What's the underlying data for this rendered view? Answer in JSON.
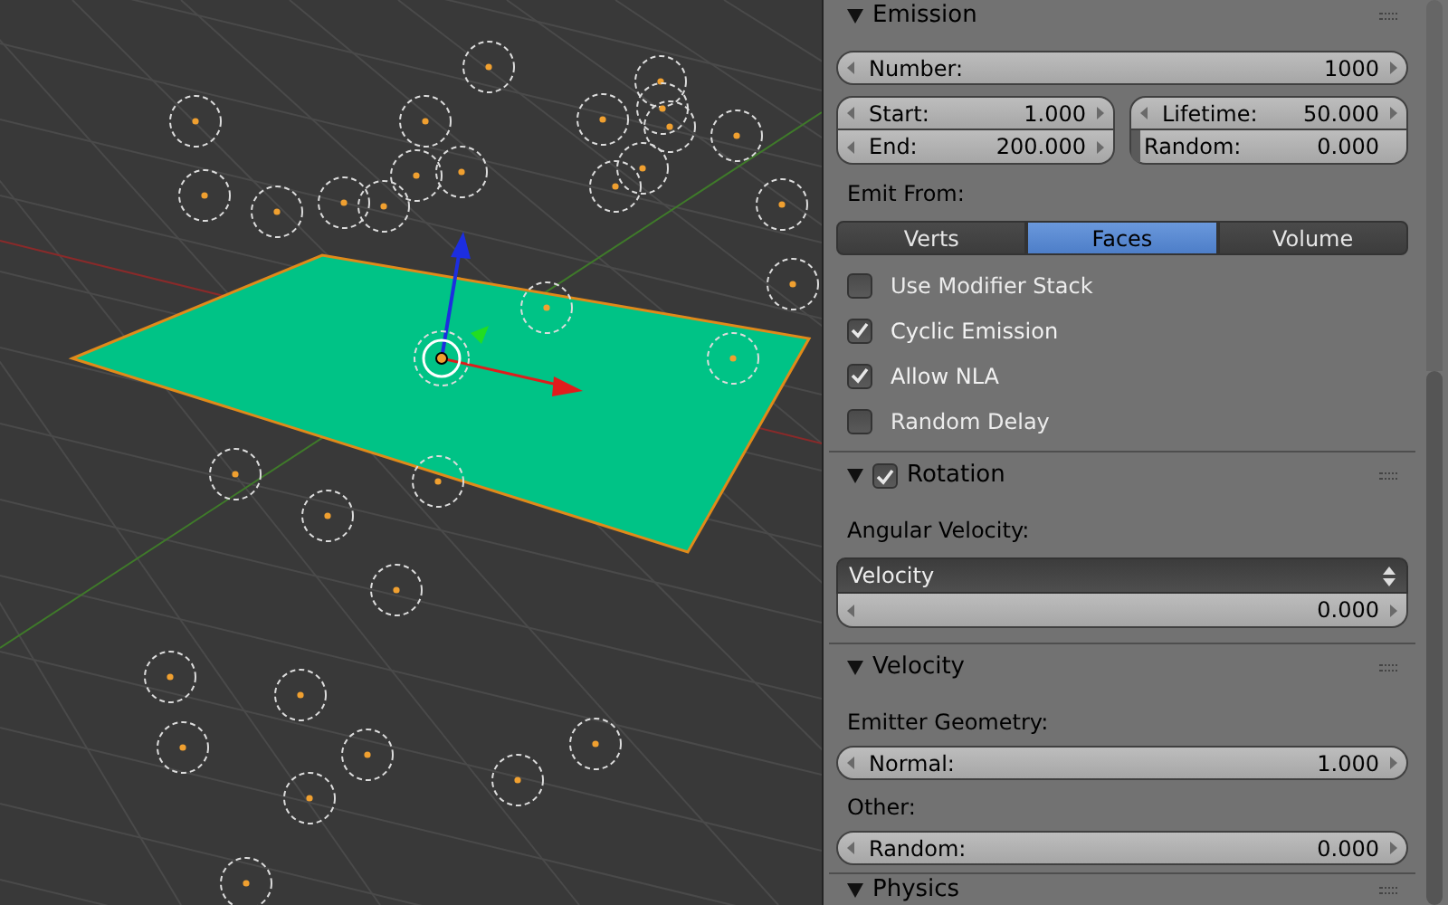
{
  "panels": [
    {
      "title": "Emission",
      "expanded": true,
      "rows": [
        {
          "kind": "field",
          "label": "Number:",
          "value": "1000"
        },
        {
          "kind": "columns",
          "columns": [
            [
              {
                "label": "Start:",
                "value": "1.000"
              },
              {
                "label": "End:",
                "value": "200.000"
              }
            ],
            [
              {
                "label": "Lifetime:",
                "value": "50.000"
              },
              {
                "label": "Random:",
                "value": "0.000",
                "level": 0
              }
            ]
          ]
        },
        {
          "kind": "label",
          "text": "Emit From:"
        },
        {
          "kind": "segmented",
          "options": [
            {
              "label": "Verts",
              "selected": false
            },
            {
              "label": "Faces",
              "selected": true
            },
            {
              "label": "Volume",
              "selected": false
            }
          ]
        },
        {
          "kind": "checkbox",
          "label": "Use Modifier Stack",
          "checked": false
        },
        {
          "kind": "checkbox",
          "label": "Cyclic Emission",
          "checked": true
        },
        {
          "kind": "checkbox",
          "label": "Allow NLA",
          "checked": true
        },
        {
          "kind": "checkbox",
          "label": "Random Delay",
          "checked": false
        }
      ]
    },
    {
      "title": "Rotation",
      "expanded": true,
      "enabled": true,
      "rows": [
        {
          "kind": "label",
          "text": "Angular Velocity:"
        },
        {
          "kind": "dropdown",
          "value": "Velocity",
          "field": {
            "value": "0.000"
          }
        }
      ]
    },
    {
      "title": "Velocity",
      "expanded": true,
      "rows": [
        {
          "kind": "label",
          "text": "Emitter Geometry:"
        },
        {
          "kind": "field",
          "label": "Normal:",
          "value": "1.000"
        },
        {
          "kind": "label",
          "text": "Other:"
        },
        {
          "kind": "field",
          "label": "Random:",
          "value": "0.000"
        }
      ]
    },
    {
      "title": "Physics",
      "expanded": true
    }
  ]
}
